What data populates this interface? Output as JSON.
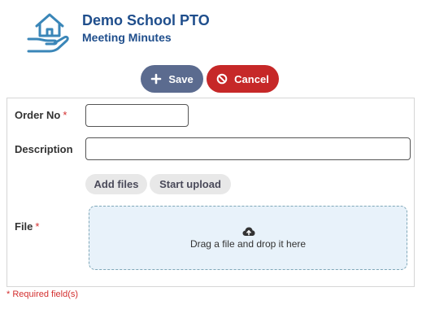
{
  "header": {
    "organization": "Demo School PTO",
    "subtitle": "Meeting Minutes",
    "logo_icon": "house-in-hand-icon"
  },
  "toolbar": {
    "save_label": "Save",
    "save_icon": "plus-icon",
    "cancel_label": "Cancel",
    "cancel_icon": "ban-icon"
  },
  "form": {
    "order_no": {
      "label": "Order No",
      "required_marker": "*",
      "value": ""
    },
    "description": {
      "label": "Description",
      "value": ""
    },
    "upload": {
      "add_files_label": "Add files",
      "start_upload_label": "Start upload"
    },
    "file": {
      "label": "File",
      "required_marker": "*",
      "dropzone_text": "Drag a file and drop it here",
      "dropzone_icon": "cloud-upload-icon"
    }
  },
  "footnote": "* Required field(s)",
  "colors": {
    "title": "#1f4e8c",
    "save_button": "#5b6b8f",
    "cancel_button": "#c62828",
    "required": "#d32f2f",
    "dropzone_bg": "#e8f2fa",
    "logo": "#3a86b8"
  }
}
